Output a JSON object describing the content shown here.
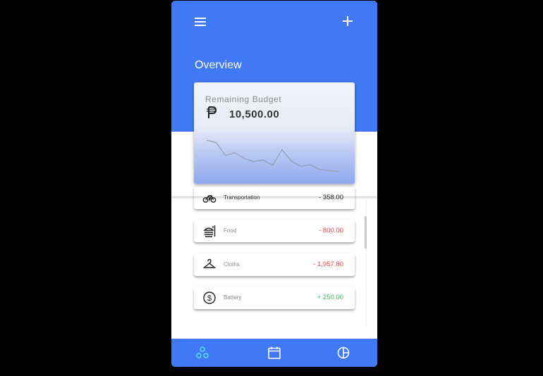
{
  "header": {
    "title": "Overview"
  },
  "budget_card": {
    "label": "Remaining Budget",
    "currency_symbol": "₱",
    "value": "10,500.00",
    "trend_values": [
      70,
      66,
      41,
      46,
      35,
      29,
      32,
      22,
      52,
      30,
      20,
      23,
      14,
      12,
      10
    ]
  },
  "transactions": [
    {
      "icon": "bicycle-icon",
      "label": "Transportation",
      "amount": "- 358.00",
      "sign": "dark"
    },
    {
      "icon": "burger-icon",
      "label": "Food",
      "amount": "- 800.00",
      "sign": "neg"
    },
    {
      "icon": "hanger-icon",
      "label": "Cloths",
      "amount": "- 1,957.80",
      "sign": "neg"
    },
    {
      "icon": "dollar-icon",
      "label": "Battery",
      "amount": "+ 250.00",
      "sign": "pos"
    }
  ],
  "bottom_nav": {
    "items": [
      "overview-icon",
      "calendar-icon",
      "pie-chart-icon"
    ],
    "active_color": "#5de0f0",
    "color": "#ffffff"
  },
  "colors": {
    "primary": "#4178f5",
    "negative": "#e5484d",
    "positive": "#3cb45a"
  }
}
